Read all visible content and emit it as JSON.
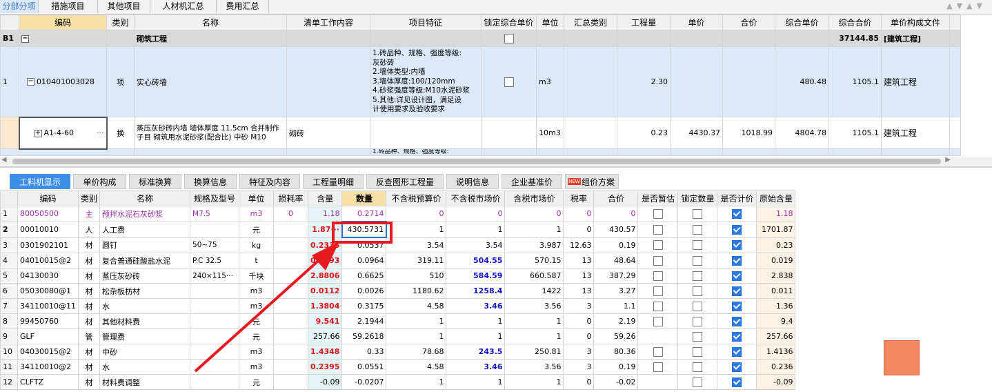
{
  "top_tabs": [
    "分部分项",
    "措施项目",
    "其他项目",
    "人材机汇总",
    "费用汇总"
  ],
  "top_headers": [
    "编码",
    "类别",
    "名称",
    "清单工作内容",
    "项目特征",
    "锁定综合单价",
    "单位",
    "汇总类别",
    "工程量",
    "单价",
    "合价",
    "综合单价",
    "综合合价",
    "单价构成文件"
  ],
  "b1": {
    "id": "B1",
    "name": "砌筑工程",
    "total": "37144.85",
    "file": "[建筑工程]"
  },
  "item1": {
    "no": "1",
    "code": "010401003028",
    "type": "项",
    "name": "实心砖墙",
    "features": [
      "1.砖品种、规格、强度等级:",
      "灰砂砖",
      "2.墙体类型:内墙",
      "3.墙体厚度:100/120mm",
      "4.砂浆强度等级:M10水泥砂浆",
      "5.其他:详见设计图，满足设",
      "计使用要求及验收要求"
    ],
    "unit": "m3",
    "qty": "2.30",
    "unit_total": "480.48",
    "total": "1105.1",
    "file": "建筑工程"
  },
  "sub1": {
    "code": "A1-4-60",
    "type": "换",
    "name": "蒸压灰砂砖内墙 墙体厚度 11.5cm  合并制作子目 砌筑用水泥砂浆(配合比) 中砂 M10",
    "work": "砌砖",
    "unit": "10m3",
    "qty": "0.23",
    "price": "4430.37",
    "sum": "1018.99",
    "unit_total": "4804.78",
    "total": "1105.1",
    "file": "建筑工程"
  },
  "partial_text": "1.砖品种、规格、强度等级:",
  "bottom_tabs": [
    "工料机显示",
    "单价构成",
    "标准换算",
    "换算信息",
    "特征及内容",
    "工程量明细",
    "反查图形工程量",
    "说明信息",
    "企业基准价",
    "组价方案"
  ],
  "new_badge": "NEW",
  "bottom_headers": [
    "编码",
    "类别",
    "名称",
    "规格及型号",
    "单位",
    "损耗率",
    "含量",
    "数量",
    "不含税预算价",
    "不含税市场价",
    "含税市场价",
    "税率",
    "合价",
    "是否暂估",
    "锁定数量",
    "是否计价",
    "原始含量"
  ],
  "rows": [
    {
      "no": "1",
      "code": "80050500",
      "type": "主",
      "name": "预拌水泥石灰砂浆",
      "spec": "M7.5",
      "unit": "m3",
      "loss": "0",
      "content": "1.18",
      "qty": "0.2714",
      "budget": "0",
      "market": "0",
      "tax_market": "0",
      "tax": "0",
      "sum": "0",
      "est": true,
      "lock": true,
      "priced": true,
      "orig": "1.18",
      "purple": true
    },
    {
      "no": "2",
      "code": "00010010",
      "type": "人",
      "name": "人工费",
      "spec": "",
      "unit": "元",
      "loss": "",
      "content": "1.87···",
      "qty": "430.5731",
      "budget": "1",
      "market": "1",
      "tax_market": "1",
      "tax": "0",
      "sum": "430.57",
      "est": true,
      "lock": true,
      "priced": true,
      "orig": "1701.87",
      "red": true
    },
    {
      "no": "3",
      "code": "0301902101",
      "type": "材",
      "name": "圆钉",
      "spec": "50~75",
      "unit": "kg",
      "loss": "",
      "content": "0.2335",
      "qty": "0.0537",
      "budget": "3.54",
      "market": "3.54",
      "tax_market": "3.987",
      "tax": "12.63",
      "sum": "0.19",
      "est": true,
      "lock": true,
      "priced": true,
      "orig": "0.23",
      "red": true
    },
    {
      "no": "4",
      "code": "04010015@2",
      "type": "材",
      "name": "复合普通硅酸盐水泥",
      "spec": "P.C 32.5",
      "unit": "t",
      "loss": "",
      "content": "0.4193",
      "qty": "0.0964",
      "budget": "319.11",
      "market": "504.55",
      "tax_market": "570.15",
      "tax": "13",
      "sum": "48.64",
      "est": true,
      "lock": true,
      "priced": true,
      "orig": "0.019",
      "red": true,
      "bluemkt": true
    },
    {
      "no": "5",
      "code": "04130030",
      "type": "材",
      "name": "蒸压灰砂砖",
      "spec": "240×115···",
      "unit": "千块",
      "loss": "",
      "content": "2.8806",
      "qty": "0.6625",
      "budget": "510",
      "market": "584.59",
      "tax_market": "660.587",
      "tax": "13",
      "sum": "387.29",
      "est": true,
      "lock": true,
      "priced": true,
      "orig": "2.838",
      "red": true,
      "bluemkt": true
    },
    {
      "no": "6",
      "code": "05030080@1",
      "type": "材",
      "name": "松杂板枋材",
      "spec": "",
      "unit": "m3",
      "loss": "",
      "content": "0.0112",
      "qty": "0.0026",
      "budget": "1180.62",
      "market": "1258.4",
      "tax_market": "1422",
      "tax": "13",
      "sum": "3.27",
      "est": true,
      "lock": true,
      "priced": true,
      "orig": "0.011",
      "red": true,
      "bluemkt": true
    },
    {
      "no": "7",
      "code": "34110010@11",
      "type": "材",
      "name": "水",
      "spec": "",
      "unit": "m3",
      "loss": "",
      "content": "1.3804",
      "qty": "0.3175",
      "budget": "4.58",
      "market": "3.46",
      "tax_market": "3.56",
      "tax": "3",
      "sum": "1.1",
      "est": true,
      "lock": true,
      "priced": true,
      "orig": "1.36",
      "red": true,
      "bluemkt": true
    },
    {
      "no": "8",
      "code": "99450760",
      "type": "材",
      "name": "其他材料费",
      "spec": "",
      "unit": "元",
      "loss": "",
      "content": "9.541",
      "qty": "2.1944",
      "budget": "1",
      "market": "1",
      "tax_market": "1",
      "tax": "0",
      "sum": "2.19",
      "est": true,
      "lock": true,
      "priced": true,
      "orig": "9.4",
      "red": true
    },
    {
      "no": "9",
      "code": "GLF",
      "type": "管",
      "name": "管理费",
      "spec": "",
      "unit": "元",
      "loss": "",
      "content": "257.66",
      "qty": "59.2618",
      "budget": "1",
      "market": "1",
      "tax_market": "1",
      "tax": "0",
      "sum": "59.26",
      "est": false,
      "lock": true,
      "priced": true,
      "orig": "257.66"
    },
    {
      "no": "10",
      "code": "04030015@2",
      "type": "材",
      "name": "中砂",
      "spec": "",
      "unit": "m3",
      "loss": "",
      "content": "1.4348",
      "qty": "0.33",
      "budget": "78.68",
      "market": "243.5",
      "tax_market": "250.81",
      "tax": "3",
      "sum": "80.36",
      "est": true,
      "lock": true,
      "priced": true,
      "orig": "1.4136",
      "red": true,
      "bluemkt": true
    },
    {
      "no": "11",
      "code": "34110010@2",
      "type": "材",
      "name": "水",
      "spec": "",
      "unit": "m3",
      "loss": "",
      "content": "0.2395",
      "qty": "0.0551",
      "budget": "4.58",
      "market": "3.46",
      "tax_market": "3.56",
      "tax": "3",
      "sum": "0.19",
      "est": true,
      "lock": true,
      "priced": true,
      "orig": "0.236",
      "red": true,
      "bluemkt": true
    },
    {
      "no": "12",
      "code": "CLFTZ",
      "type": "材",
      "name": "材料费调整",
      "spec": "",
      "unit": "元",
      "loss": "",
      "content": "-0.09",
      "qty": "-0.0207",
      "budget": "1",
      "market": "1",
      "tax_market": "1",
      "tax": "0",
      "sum": "-0.02",
      "est": false,
      "lock": true,
      "priced": true,
      "orig": "-0.09"
    }
  ],
  "colors": {
    "accent": "#3d8ee6",
    "highlight": "#e8191f",
    "orange": "#f4875f"
  }
}
